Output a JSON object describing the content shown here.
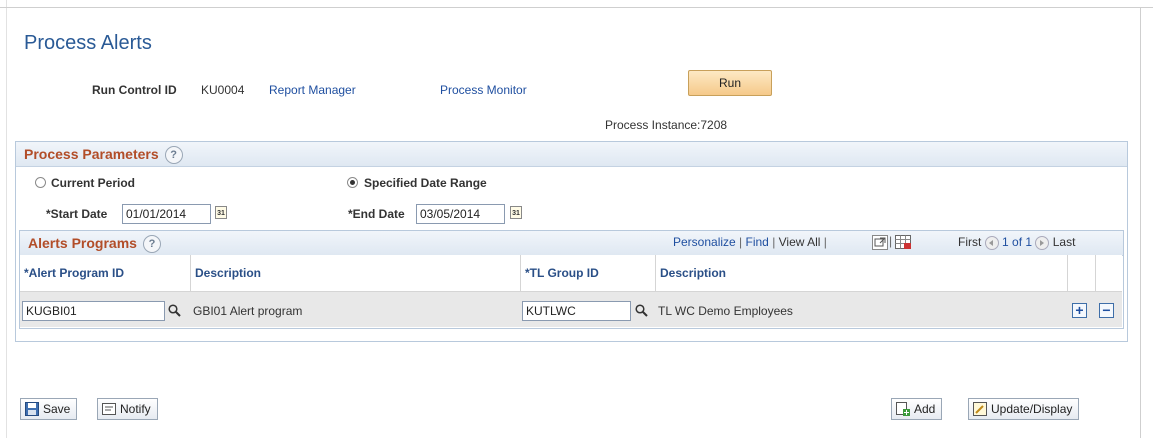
{
  "page": {
    "title": "Process Alerts"
  },
  "run_control": {
    "label": "Run Control ID",
    "value": "KU0004",
    "report_manager": "Report Manager",
    "process_monitor": "Process Monitor",
    "run_button": "Run",
    "process_instance": "Process Instance:7208"
  },
  "process_parameters": {
    "title": "Process Parameters",
    "help": "?",
    "radio_current_period": "Current Period",
    "radio_specified_range": "Specified Date Range",
    "selected": "Specified Date Range",
    "start_date_label": "*Start Date",
    "start_date_value": "01/01/2014",
    "end_date_label": "*End Date",
    "end_date_value": "03/05/2014",
    "calendar_glyph": "31"
  },
  "alerts_programs": {
    "title": "Alerts Programs",
    "help": "?",
    "nav": {
      "personalize": "Personalize",
      "find": "Find",
      "view_all": "View All",
      "first": "First",
      "range": "1 of 1",
      "last": "Last"
    },
    "columns": [
      "*Alert Program ID",
      "Description",
      "*TL Group ID",
      "Description"
    ],
    "rows": [
      {
        "alert_program_id": "KUGBI01",
        "alert_description": "GBI01 Alert program",
        "tl_group_id": "KUTLWC",
        "group_description": "TL WC Demo Employees"
      }
    ],
    "add_row": "+",
    "delete_row": "−"
  },
  "toolbar": {
    "save": "Save",
    "notify": "Notify",
    "add": "Add",
    "update_display": "Update/Display"
  },
  "colors": {
    "title_blue": "#2a5a96",
    "section_title": "#b24d28",
    "link": "#1f4fa0",
    "button_bg": "#f5c98a"
  }
}
